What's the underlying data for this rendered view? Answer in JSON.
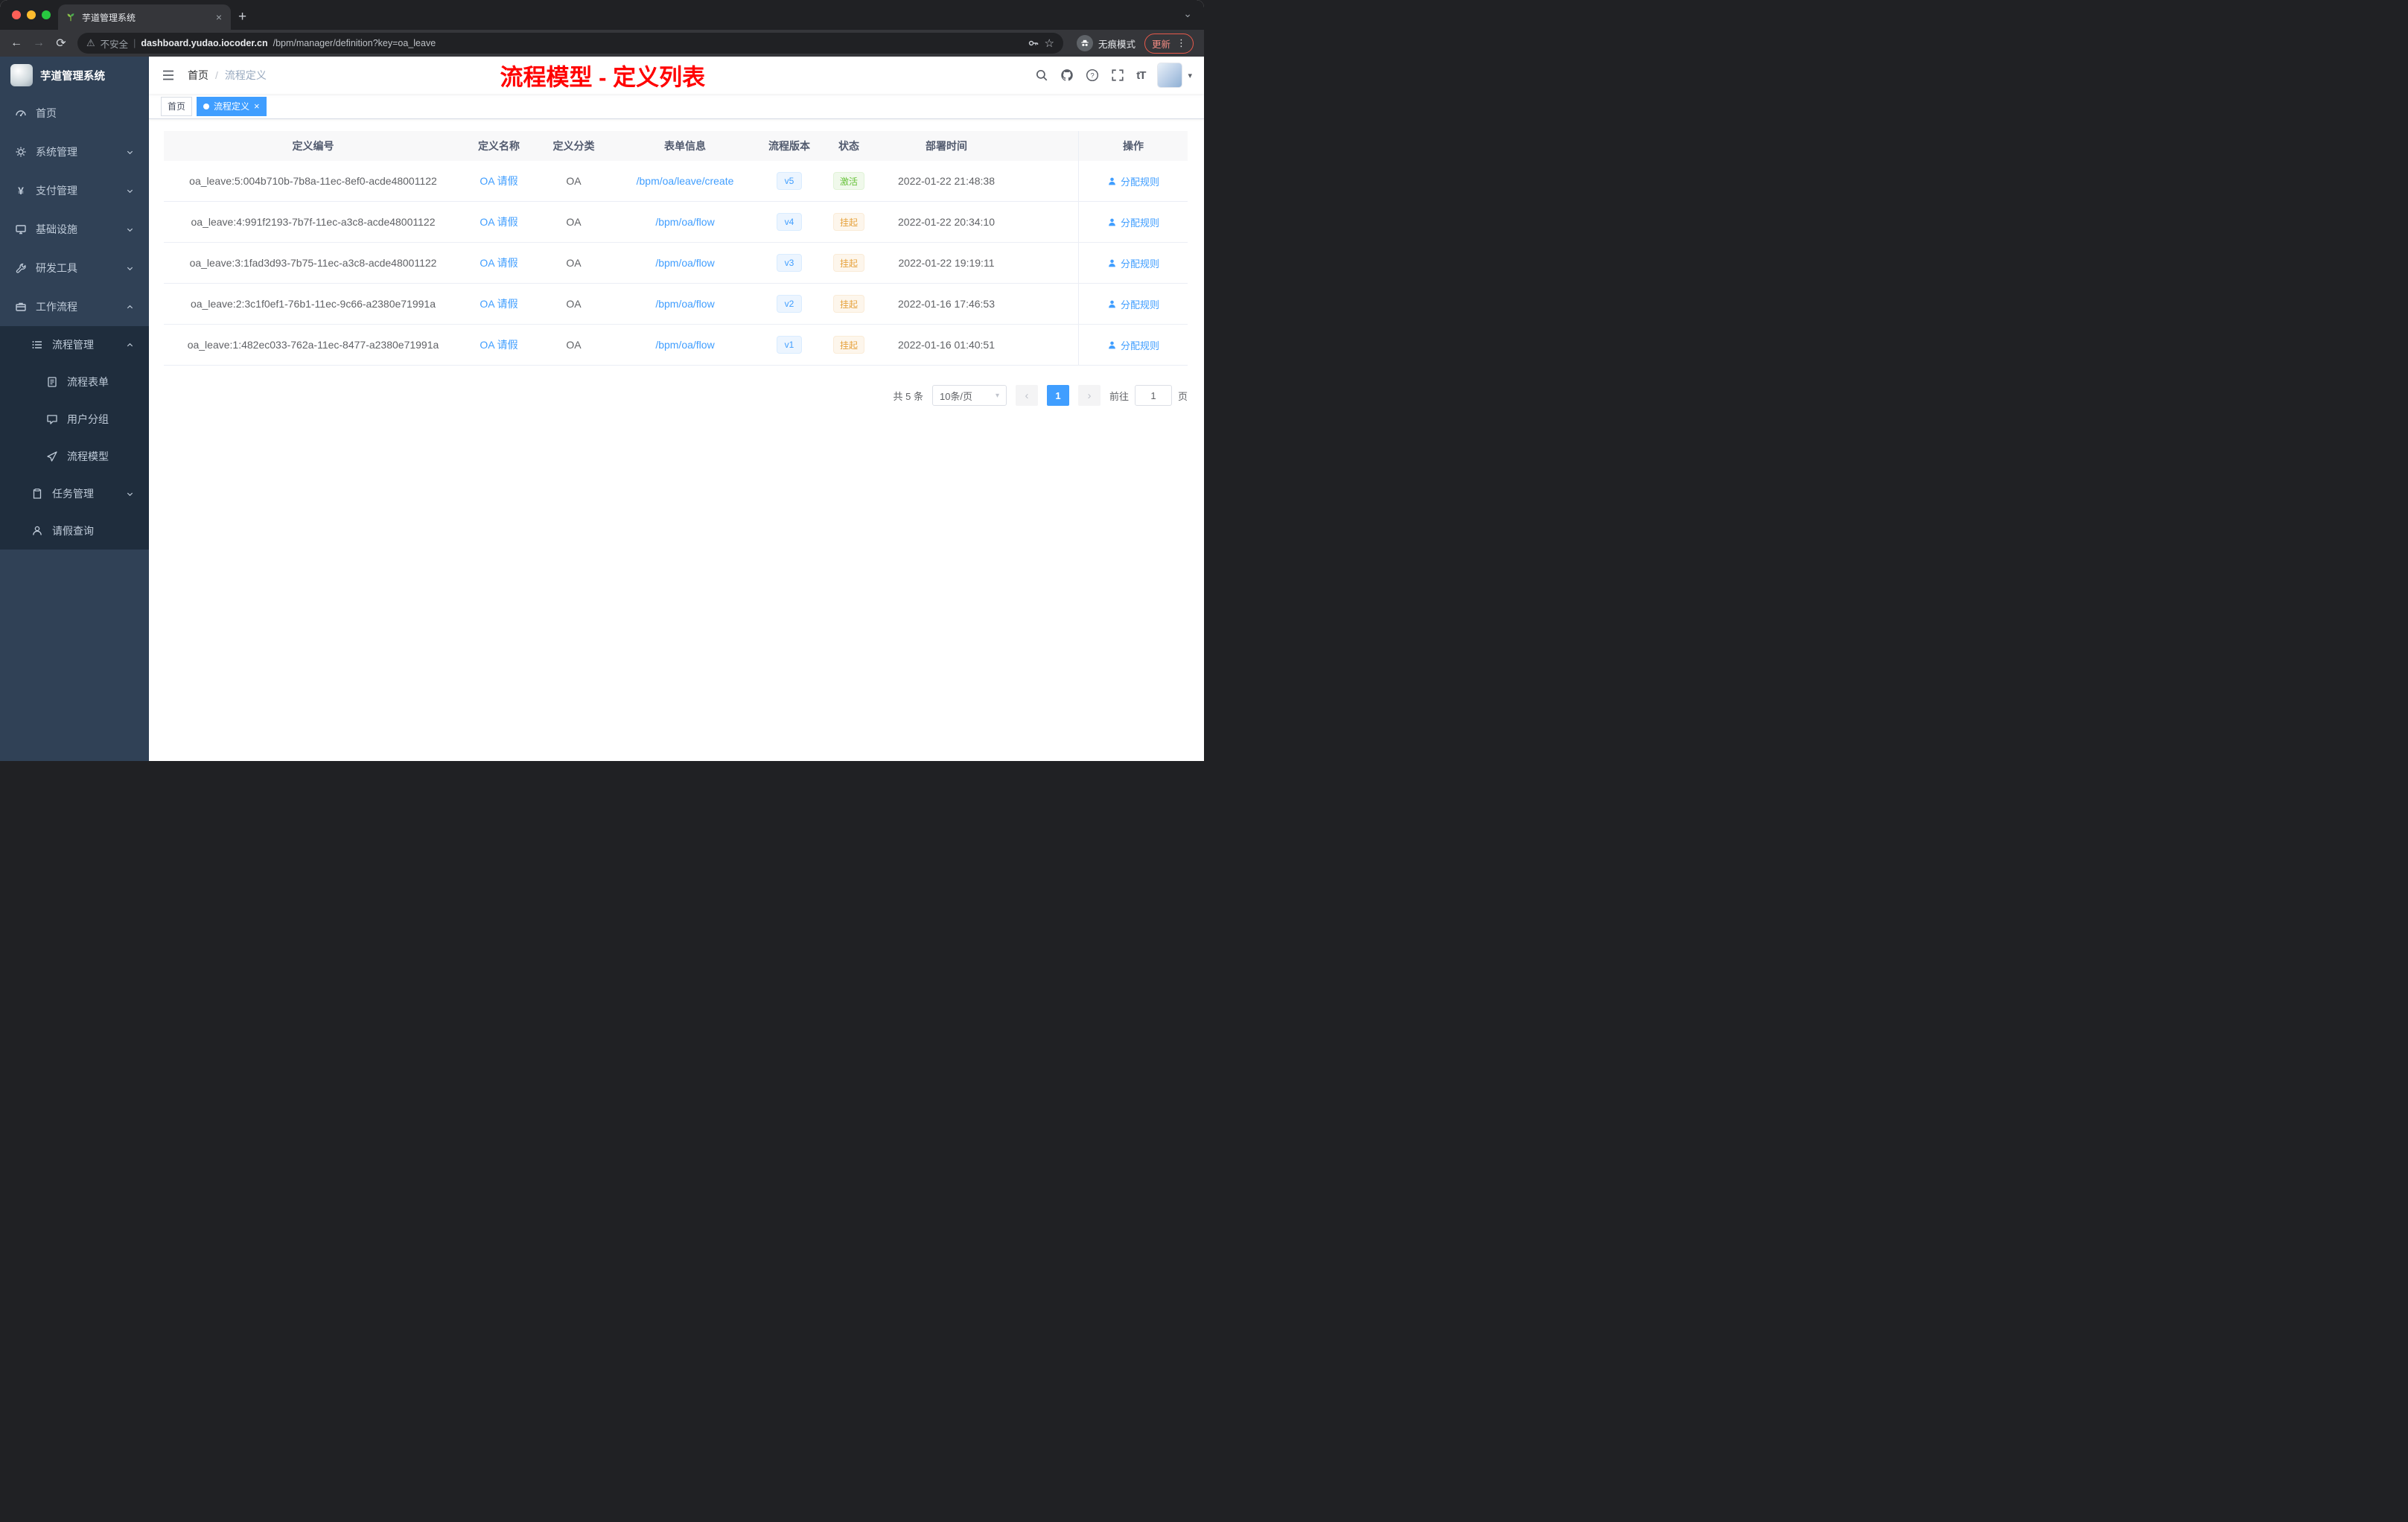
{
  "browser": {
    "tab_title": "芋道管理系统",
    "security_warning": "不安全",
    "url_host": "dashboard.yudao.iocoder.cn",
    "url_path": "/bpm/manager/definition?key=oa_leave",
    "incognito_label": "无痕模式",
    "update_label": "更新"
  },
  "icons": {
    "back": "←",
    "forward": "→",
    "reload": "⟳",
    "warning": "⚠",
    "divider": "|",
    "star": "☆",
    "kebab": "⋮",
    "tab_close": "×",
    "new_tab": "+",
    "tab_search": "⌄",
    "caret_down": "▾",
    "yen": "¥",
    "font_size": "tT",
    "prev": "‹",
    "next": "›",
    "tag_close": "×"
  },
  "sidebar": {
    "brand": "芋道管理系统",
    "items": {
      "home": "首页",
      "system": "系统管理",
      "payment": "支付管理",
      "infra": "基础设施",
      "dev_tools": "研发工具",
      "workflow": "工作流程",
      "process_mgmt": "流程管理",
      "process_form": "流程表单",
      "user_group": "用户分组",
      "process_model": "流程模型",
      "task_mgmt": "任务管理",
      "leave_query": "请假查询"
    }
  },
  "navbar": {
    "breadcrumb_home": "首页",
    "breadcrumb_separator": "/",
    "breadcrumb_current": "流程定义",
    "annotation": "流程模型 - 定义列表"
  },
  "tags": {
    "home": "首页",
    "active": "流程定义"
  },
  "table": {
    "headers": [
      "定义编号",
      "定义名称",
      "定义分类",
      "表单信息",
      "流程版本",
      "状态",
      "部署时间",
      "操作"
    ],
    "rows": [
      {
        "id": "oa_leave:5:004b710b-7b8a-11ec-8ef0-acde48001122",
        "name": "OA 请假",
        "category": "OA",
        "form": "/bpm/oa/leave/create",
        "version": "v5",
        "status": "激活",
        "status_type": "success",
        "deploy_time": "2022-01-22 21:48:38",
        "action": "分配规则"
      },
      {
        "id": "oa_leave:4:991f2193-7b7f-11ec-a3c8-acde48001122",
        "name": "OA 请假",
        "category": "OA",
        "form": "/bpm/oa/flow",
        "version": "v4",
        "status": "挂起",
        "status_type": "warning",
        "deploy_time": "2022-01-22 20:34:10",
        "action": "分配规则"
      },
      {
        "id": "oa_leave:3:1fad3d93-7b75-11ec-a3c8-acde48001122",
        "name": "OA 请假",
        "category": "OA",
        "form": "/bpm/oa/flow",
        "version": "v3",
        "status": "挂起",
        "status_type": "warning",
        "deploy_time": "2022-01-22 19:19:11",
        "action": "分配规则"
      },
      {
        "id": "oa_leave:2:3c1f0ef1-76b1-11ec-9c66-a2380e71991a",
        "name": "OA 请假",
        "category": "OA",
        "form": "/bpm/oa/flow",
        "version": "v2",
        "status": "挂起",
        "status_type": "warning",
        "deploy_time": "2022-01-16 17:46:53",
        "action": "分配规则"
      },
      {
        "id": "oa_leave:1:482ec033-762a-11ec-8477-a2380e71991a",
        "name": "OA 请假",
        "category": "OA",
        "form": "/bpm/oa/flow",
        "version": "v1",
        "status": "挂起",
        "status_type": "warning",
        "deploy_time": "2022-01-16 01:40:51",
        "action": "分配规则"
      }
    ]
  },
  "pagination": {
    "total": "共 5 条",
    "page_size": "10条/页",
    "current_page": "1",
    "goto_label": "前往",
    "goto_value": "1",
    "page_unit": "页"
  },
  "colors": {
    "accent": "#409EFF",
    "success": "#67C23A",
    "warning": "#E6A23C",
    "annotation": "#FF0000",
    "sidebar_bg": "#304156",
    "submenu_bg": "#1F2D3D"
  }
}
